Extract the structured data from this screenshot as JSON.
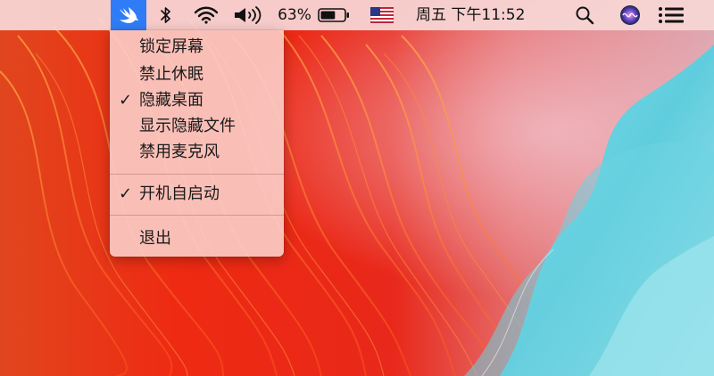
{
  "menubar": {
    "app_icon": "swift-bird-icon",
    "bluetooth_icon": "bluetooth-icon",
    "wifi_icon": "wifi-icon",
    "volume_icon": "volume-icon",
    "battery_percent": "63%",
    "battery_level": 0.63,
    "input_source_icon": "us-flag-icon",
    "clock": "周五 下午11:52",
    "spotlight_icon": "search-icon",
    "siri_icon": "siri-icon",
    "notification_center_icon": "list-icon",
    "accent_color": "#2f7cf6"
  },
  "dropdown": {
    "items": [
      {
        "label": "锁定屏幕",
        "checked": false
      },
      {
        "label": "禁止休眠",
        "checked": false
      },
      {
        "label": "隐藏桌面",
        "checked": true
      },
      {
        "label": "显示隐藏文件",
        "checked": false
      },
      {
        "label": "禁用麦克风",
        "checked": false
      },
      {
        "label": "开机自启动",
        "checked": true
      },
      {
        "label": "退出",
        "checked": false
      }
    ],
    "check_glyph": "✓"
  }
}
